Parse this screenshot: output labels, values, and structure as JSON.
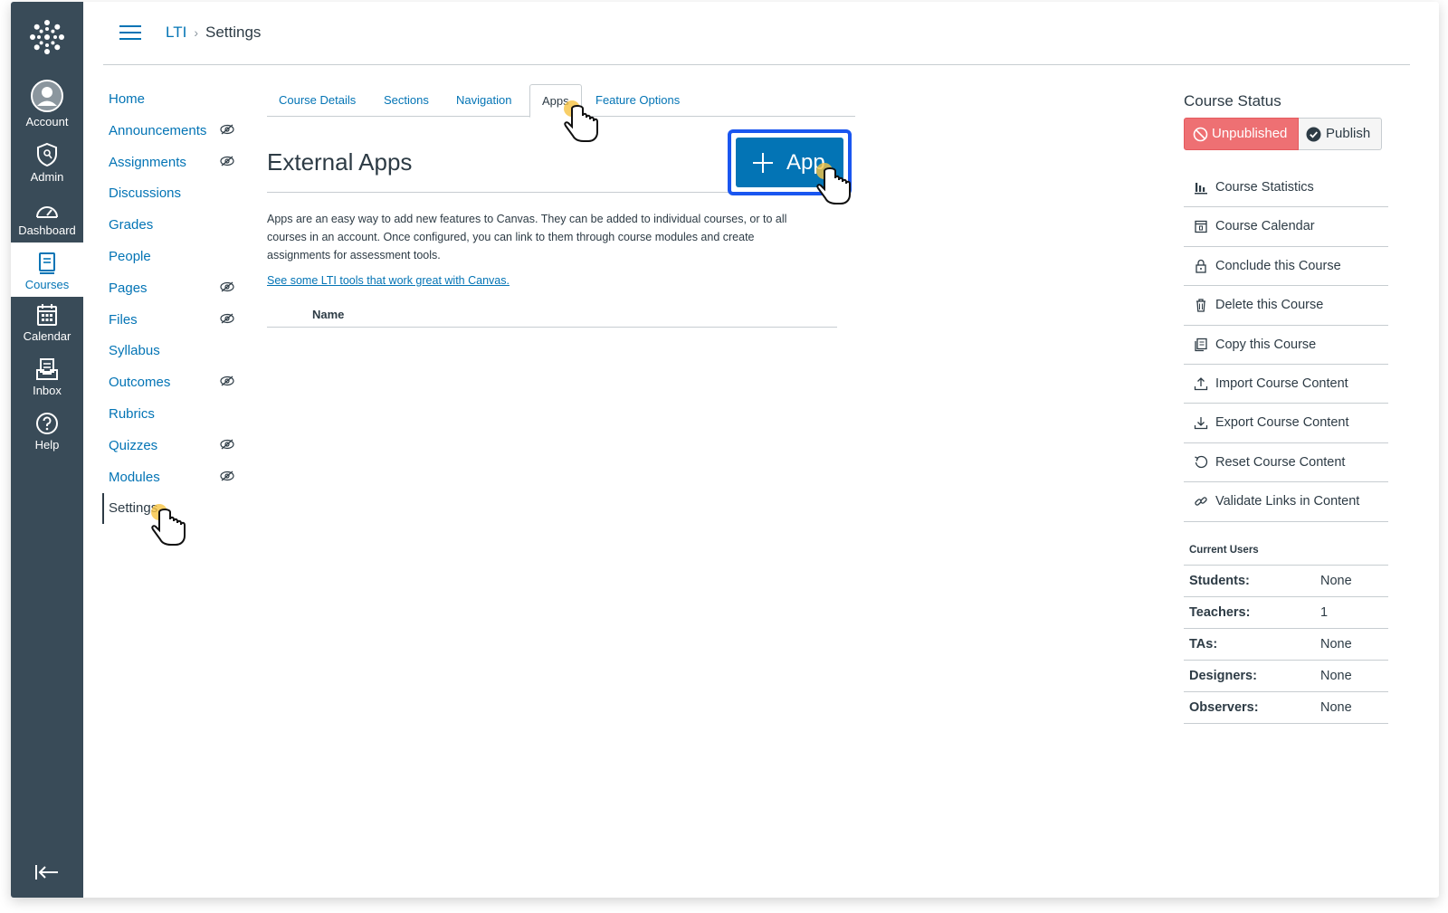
{
  "global_nav": {
    "items": [
      {
        "label": "Account",
        "icon": "account-icon"
      },
      {
        "label": "Admin",
        "icon": "admin-shield-icon"
      },
      {
        "label": "Dashboard",
        "icon": "dashboard-icon"
      },
      {
        "label": "Courses",
        "icon": "courses-icon"
      },
      {
        "label": "Calendar",
        "icon": "calendar-icon"
      },
      {
        "label": "Inbox",
        "icon": "inbox-icon"
      },
      {
        "label": "Help",
        "icon": "help-icon"
      }
    ],
    "active": "Courses"
  },
  "header": {
    "breadcrumb": {
      "course": "LTI",
      "current": "Settings"
    }
  },
  "course_nav": {
    "items": [
      {
        "label": "Home"
      },
      {
        "label": "Announcements",
        "hidden": true
      },
      {
        "label": "Assignments",
        "hidden": true
      },
      {
        "label": "Discussions"
      },
      {
        "label": "Grades"
      },
      {
        "label": "People"
      },
      {
        "label": "Pages",
        "hidden": true
      },
      {
        "label": "Files",
        "hidden": true
      },
      {
        "label": "Syllabus"
      },
      {
        "label": "Outcomes",
        "hidden": true
      },
      {
        "label": "Rubrics"
      },
      {
        "label": "Quizzes",
        "hidden": true
      },
      {
        "label": "Modules",
        "hidden": true
      },
      {
        "label": "Settings",
        "active": true
      }
    ]
  },
  "tabs": [
    {
      "label": "Course Details"
    },
    {
      "label": "Sections"
    },
    {
      "label": "Navigation"
    },
    {
      "label": "Apps",
      "active": true
    },
    {
      "label": "Feature Options"
    }
  ],
  "main": {
    "heading": "External Apps",
    "add_button": "App",
    "description": "Apps are an easy way to add new features to Canvas. They can be added to individual courses, or to all courses in an account. Once configured, you can link to them through course modules and create assignments for assessment tools.",
    "link": "See some LTI tools that work great with Canvas.",
    "table_header": "Name"
  },
  "sidebar": {
    "status_title": "Course Status",
    "unpublished": "Unpublished",
    "publish": "Publish",
    "actions": [
      {
        "label": "Course Statistics",
        "icon": "bar-chart-icon"
      },
      {
        "label": "Course Calendar",
        "icon": "calendar-icon"
      },
      {
        "label": "Conclude this Course",
        "icon": "lock-icon"
      },
      {
        "label": "Delete this Course",
        "icon": "trash-icon"
      },
      {
        "label": "Copy this Course",
        "icon": "copy-icon"
      },
      {
        "label": "Import Course Content",
        "icon": "upload-icon"
      },
      {
        "label": "Export Course Content",
        "icon": "download-icon"
      },
      {
        "label": "Reset Course Content",
        "icon": "reset-icon"
      },
      {
        "label": "Validate Links in Content",
        "icon": "link-icon"
      }
    ],
    "current_users_title": "Current Users",
    "current_users": [
      {
        "role": "Students:",
        "count": "None"
      },
      {
        "role": "Teachers:",
        "count": "1"
      },
      {
        "role": "TAs:",
        "count": "None"
      },
      {
        "role": "Designers:",
        "count": "None"
      },
      {
        "role": "Observers:",
        "count": "None"
      }
    ]
  },
  "colors": {
    "nav_bg": "#394b58",
    "link": "#0374b5",
    "unpublished": "#ee7073",
    "highlight": "#1a56f0"
  }
}
